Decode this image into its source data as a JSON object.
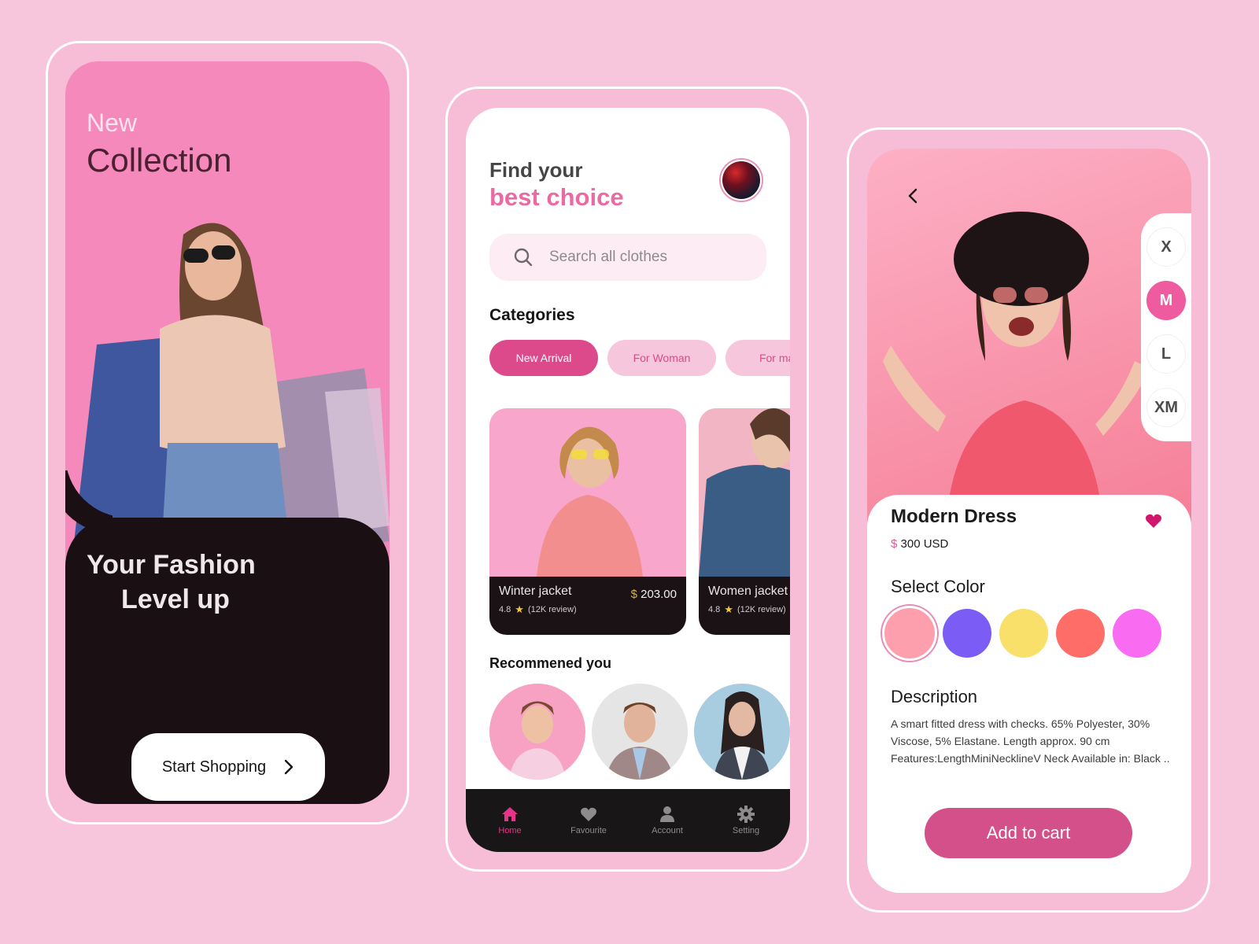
{
  "colors": {
    "background": "#f8c6dc",
    "accent_pink": "#dd4a8b",
    "hero_pink": "#f589bb",
    "dark": "#1a0f12"
  },
  "screen1": {
    "title_small": "New",
    "title_large": "Collection",
    "tagline_line1": "Your Fashion",
    "tagline_line2": "Level up",
    "cta_label": "Start Shopping",
    "cta_icon": "chevron-right-icon"
  },
  "screen2": {
    "heading_line1": "Find your",
    "heading_line2": "best choice",
    "search": {
      "placeholder": "Search all clothes",
      "icon": "search-icon"
    },
    "categories_title": "Categories",
    "categories": [
      {
        "label": "New Arrival",
        "active": true
      },
      {
        "label": "For Woman",
        "active": false
      },
      {
        "label": "For man",
        "active": false
      }
    ],
    "products": [
      {
        "name": "Winter jacket",
        "currency": "$",
        "price": "203.00",
        "rating": "4.8",
        "reviews": "(12K review)"
      },
      {
        "name": "Women jacket",
        "rating": "4.8",
        "reviews": "(12K review)"
      }
    ],
    "recommended_title": "Recommened you",
    "bottom_nav": [
      {
        "label": "Home",
        "icon": "home-icon",
        "active": true
      },
      {
        "label": "Favourite",
        "icon": "heart-icon",
        "active": false
      },
      {
        "label": "Account",
        "icon": "user-icon",
        "active": false
      },
      {
        "label": "Setting",
        "icon": "gear-icon",
        "active": false
      }
    ]
  },
  "screen3": {
    "back_icon": "chevron-left-icon",
    "sizes": [
      {
        "label": "X",
        "active": false
      },
      {
        "label": "M",
        "active": true
      },
      {
        "label": "L",
        "active": false
      },
      {
        "label": "XM",
        "active": false
      }
    ],
    "product_name": "Modern Dress",
    "currency": "$",
    "price": "300 USD",
    "favorite": true,
    "select_color_title": "Select Color",
    "color_options": [
      "#fd9fad",
      "#7b5cf5",
      "#f8e06a",
      "#fe6d68",
      "#f96bf0"
    ],
    "selected_color_index": 0,
    "description_title": "Description",
    "description": "A smart fitted dress with checks. 65% Polyester, 30% Viscose, 5% Elastane. Length approx. 90 cm Features:LengthMiniNecklineV Neck Available in: Black ..",
    "add_to_cart_label": "Add to cart"
  }
}
